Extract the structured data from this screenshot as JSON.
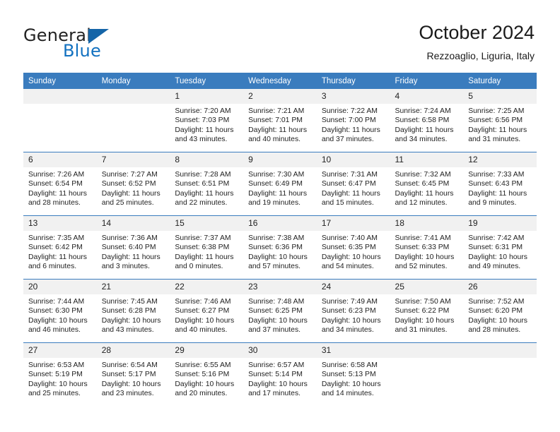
{
  "brand": {
    "name_top": "General",
    "name_bottom": "Blue",
    "accent_color": "#1271c0",
    "triangle_color": "#1565a8"
  },
  "header": {
    "title": "October 2024",
    "subtitle": "Rezzoaglio, Liguria, Italy"
  },
  "theme": {
    "header_row_bg": "#3a7cbe",
    "daynum_bg": "#f1f1f1",
    "grid_line": "#3a7cbe"
  },
  "weekdays": [
    "Sunday",
    "Monday",
    "Tuesday",
    "Wednesday",
    "Thursday",
    "Friday",
    "Saturday"
  ],
  "weeks": [
    [
      {
        "day": "",
        "sunrise": "",
        "sunset": "",
        "daylight": "",
        "empty": true
      },
      {
        "day": "",
        "sunrise": "",
        "sunset": "",
        "daylight": "",
        "empty": true
      },
      {
        "day": "1",
        "sunrise": "Sunrise: 7:20 AM",
        "sunset": "Sunset: 7:03 PM",
        "daylight": "Daylight: 11 hours and 43 minutes."
      },
      {
        "day": "2",
        "sunrise": "Sunrise: 7:21 AM",
        "sunset": "Sunset: 7:01 PM",
        "daylight": "Daylight: 11 hours and 40 minutes."
      },
      {
        "day": "3",
        "sunrise": "Sunrise: 7:22 AM",
        "sunset": "Sunset: 7:00 PM",
        "daylight": "Daylight: 11 hours and 37 minutes."
      },
      {
        "day": "4",
        "sunrise": "Sunrise: 7:24 AM",
        "sunset": "Sunset: 6:58 PM",
        "daylight": "Daylight: 11 hours and 34 minutes."
      },
      {
        "day": "5",
        "sunrise": "Sunrise: 7:25 AM",
        "sunset": "Sunset: 6:56 PM",
        "daylight": "Daylight: 11 hours and 31 minutes."
      }
    ],
    [
      {
        "day": "6",
        "sunrise": "Sunrise: 7:26 AM",
        "sunset": "Sunset: 6:54 PM",
        "daylight": "Daylight: 11 hours and 28 minutes."
      },
      {
        "day": "7",
        "sunrise": "Sunrise: 7:27 AM",
        "sunset": "Sunset: 6:52 PM",
        "daylight": "Daylight: 11 hours and 25 minutes."
      },
      {
        "day": "8",
        "sunrise": "Sunrise: 7:28 AM",
        "sunset": "Sunset: 6:51 PM",
        "daylight": "Daylight: 11 hours and 22 minutes."
      },
      {
        "day": "9",
        "sunrise": "Sunrise: 7:30 AM",
        "sunset": "Sunset: 6:49 PM",
        "daylight": "Daylight: 11 hours and 19 minutes."
      },
      {
        "day": "10",
        "sunrise": "Sunrise: 7:31 AM",
        "sunset": "Sunset: 6:47 PM",
        "daylight": "Daylight: 11 hours and 15 minutes."
      },
      {
        "day": "11",
        "sunrise": "Sunrise: 7:32 AM",
        "sunset": "Sunset: 6:45 PM",
        "daylight": "Daylight: 11 hours and 12 minutes."
      },
      {
        "day": "12",
        "sunrise": "Sunrise: 7:33 AM",
        "sunset": "Sunset: 6:43 PM",
        "daylight": "Daylight: 11 hours and 9 minutes."
      }
    ],
    [
      {
        "day": "13",
        "sunrise": "Sunrise: 7:35 AM",
        "sunset": "Sunset: 6:42 PM",
        "daylight": "Daylight: 11 hours and 6 minutes."
      },
      {
        "day": "14",
        "sunrise": "Sunrise: 7:36 AM",
        "sunset": "Sunset: 6:40 PM",
        "daylight": "Daylight: 11 hours and 3 minutes."
      },
      {
        "day": "15",
        "sunrise": "Sunrise: 7:37 AM",
        "sunset": "Sunset: 6:38 PM",
        "daylight": "Daylight: 11 hours and 0 minutes."
      },
      {
        "day": "16",
        "sunrise": "Sunrise: 7:38 AM",
        "sunset": "Sunset: 6:36 PM",
        "daylight": "Daylight: 10 hours and 57 minutes."
      },
      {
        "day": "17",
        "sunrise": "Sunrise: 7:40 AM",
        "sunset": "Sunset: 6:35 PM",
        "daylight": "Daylight: 10 hours and 54 minutes."
      },
      {
        "day": "18",
        "sunrise": "Sunrise: 7:41 AM",
        "sunset": "Sunset: 6:33 PM",
        "daylight": "Daylight: 10 hours and 52 minutes."
      },
      {
        "day": "19",
        "sunrise": "Sunrise: 7:42 AM",
        "sunset": "Sunset: 6:31 PM",
        "daylight": "Daylight: 10 hours and 49 minutes."
      }
    ],
    [
      {
        "day": "20",
        "sunrise": "Sunrise: 7:44 AM",
        "sunset": "Sunset: 6:30 PM",
        "daylight": "Daylight: 10 hours and 46 minutes."
      },
      {
        "day": "21",
        "sunrise": "Sunrise: 7:45 AM",
        "sunset": "Sunset: 6:28 PM",
        "daylight": "Daylight: 10 hours and 43 minutes."
      },
      {
        "day": "22",
        "sunrise": "Sunrise: 7:46 AM",
        "sunset": "Sunset: 6:27 PM",
        "daylight": "Daylight: 10 hours and 40 minutes."
      },
      {
        "day": "23",
        "sunrise": "Sunrise: 7:48 AM",
        "sunset": "Sunset: 6:25 PM",
        "daylight": "Daylight: 10 hours and 37 minutes."
      },
      {
        "day": "24",
        "sunrise": "Sunrise: 7:49 AM",
        "sunset": "Sunset: 6:23 PM",
        "daylight": "Daylight: 10 hours and 34 minutes."
      },
      {
        "day": "25",
        "sunrise": "Sunrise: 7:50 AM",
        "sunset": "Sunset: 6:22 PM",
        "daylight": "Daylight: 10 hours and 31 minutes."
      },
      {
        "day": "26",
        "sunrise": "Sunrise: 7:52 AM",
        "sunset": "Sunset: 6:20 PM",
        "daylight": "Daylight: 10 hours and 28 minutes."
      }
    ],
    [
      {
        "day": "27",
        "sunrise": "Sunrise: 6:53 AM",
        "sunset": "Sunset: 5:19 PM",
        "daylight": "Daylight: 10 hours and 25 minutes."
      },
      {
        "day": "28",
        "sunrise": "Sunrise: 6:54 AM",
        "sunset": "Sunset: 5:17 PM",
        "daylight": "Daylight: 10 hours and 23 minutes."
      },
      {
        "day": "29",
        "sunrise": "Sunrise: 6:55 AM",
        "sunset": "Sunset: 5:16 PM",
        "daylight": "Daylight: 10 hours and 20 minutes."
      },
      {
        "day": "30",
        "sunrise": "Sunrise: 6:57 AM",
        "sunset": "Sunset: 5:14 PM",
        "daylight": "Daylight: 10 hours and 17 minutes."
      },
      {
        "day": "31",
        "sunrise": "Sunrise: 6:58 AM",
        "sunset": "Sunset: 5:13 PM",
        "daylight": "Daylight: 10 hours and 14 minutes."
      },
      {
        "day": "",
        "sunrise": "",
        "sunset": "",
        "daylight": "",
        "empty": true
      },
      {
        "day": "",
        "sunrise": "",
        "sunset": "",
        "daylight": "",
        "empty": true
      }
    ]
  ]
}
